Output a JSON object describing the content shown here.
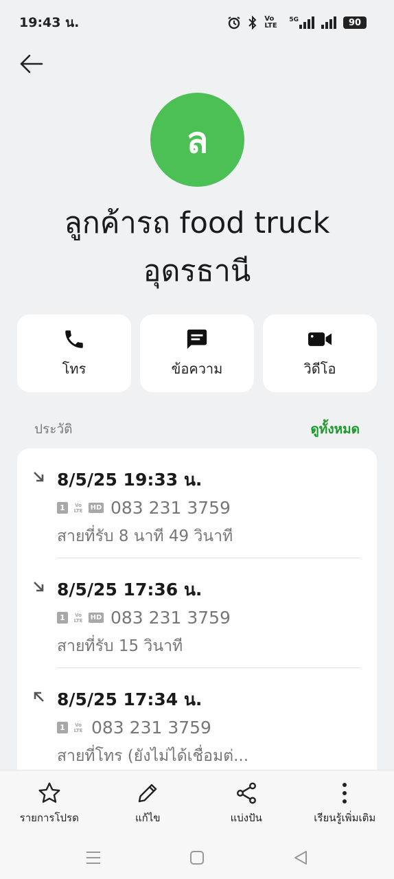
{
  "status_bar": {
    "time": "19:43 น.",
    "volte": "Vo LTE",
    "network": "5G",
    "battery": "90"
  },
  "contact": {
    "initial": "ล",
    "name": "ลูกค้ารถ food truck อุดรธานี",
    "avatar_color": "#4cbf55"
  },
  "actions": [
    {
      "label": "โทร",
      "icon": "phone-icon"
    },
    {
      "label": "ข้อความ",
      "icon": "message-icon"
    },
    {
      "label": "วิดีโอ",
      "icon": "video-camera-icon"
    }
  ],
  "history": {
    "title": "ประวัติ",
    "view_all": "ดูทั้งหมด",
    "calls": [
      {
        "direction": "incoming",
        "date": "8/5/25 19:33 น.",
        "sim": "1",
        "hd": "HD",
        "number": "083 231 3759",
        "status": "สายที่รับ  8 นาที 49 วินาที"
      },
      {
        "direction": "incoming",
        "date": "8/5/25 17:36 น.",
        "sim": "1",
        "hd": "HD",
        "number": "083 231 3759",
        "status": "สายที่รับ  15 วินาที"
      },
      {
        "direction": "outgoing",
        "date": "8/5/25 17:34 น.",
        "sim": "1",
        "number": "083 231 3759",
        "status": "สายที่โทร (ยังไม่ได้เชื่อมต่..."
      }
    ]
  },
  "bottom_actions": [
    {
      "label": "รายการโปรด",
      "icon": "star-icon"
    },
    {
      "label": "แก้ไข",
      "icon": "pencil-icon"
    },
    {
      "label": "แบ่งปัน",
      "icon": "share-icon"
    },
    {
      "label": "เรียนรู้เพิ่มเติม",
      "icon": "more-vertical-icon"
    }
  ],
  "colors": {
    "accent_green": "#1c9a2c",
    "background": "#f0f1f3"
  }
}
